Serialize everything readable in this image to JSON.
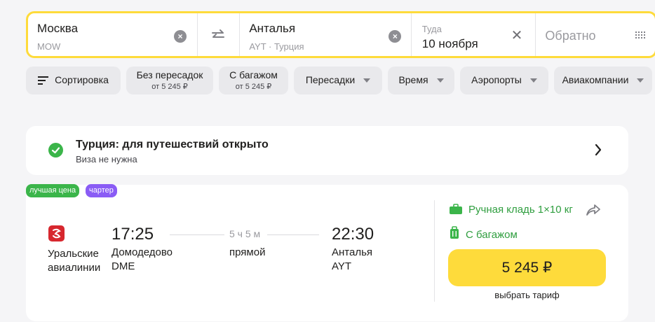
{
  "search": {
    "from": {
      "city": "Москва",
      "code": "MOW"
    },
    "to": {
      "city": "Анталья",
      "code": "AYT · Турция"
    },
    "date_label": "Туда",
    "date_value": "10 ноября",
    "return_placeholder": "Обратно"
  },
  "filters": {
    "sort": "Сортировка",
    "nonstop": {
      "label": "Без пересадок",
      "price": "от 5 245 ₽"
    },
    "baggage": {
      "label": "С багажом",
      "price": "от 5 245 ₽"
    },
    "transfers": "Пересадки",
    "time": "Время",
    "airports": "Аэропорты",
    "airlines": "Авиакомпании"
  },
  "info": {
    "title": "Турция: для путешествий открыто",
    "subtitle": "Виза не нужна"
  },
  "badges": {
    "best": "лучшая цена",
    "charter": "чартер"
  },
  "flight": {
    "airline_line1": "Уральские",
    "airline_line2": "авиалинии",
    "dep_time": "17:25",
    "dep_airport": "Домодедово",
    "dep_code": "DME",
    "duration": "5 ч 5 м",
    "stops": "прямой",
    "arr_time": "22:30",
    "arr_city": "Анталья",
    "arr_code": "AYT",
    "hand_luggage": "Ручная кладь 1×10 кг",
    "baggage": "С багажом",
    "price": "5 245 ₽",
    "tariff": "выбрать тариф"
  },
  "colors": {
    "accent": "#fedb3b",
    "green": "#3bb54a",
    "charter": "#8a5cf5",
    "airline": "#d7272e"
  }
}
